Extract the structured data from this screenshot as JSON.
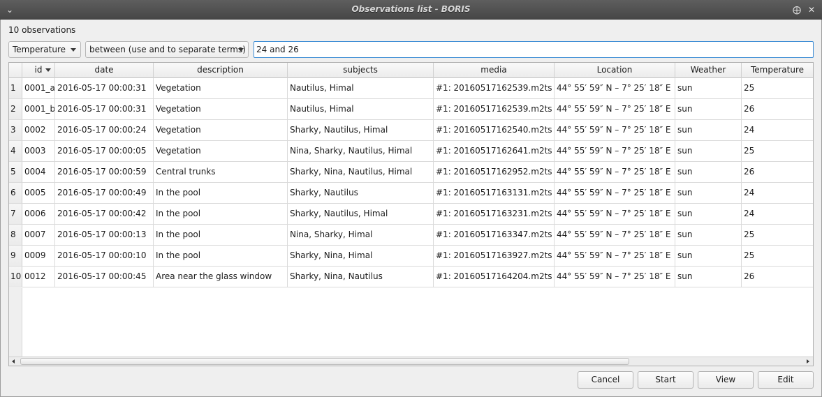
{
  "window": {
    "title": "Observations list - BORIS"
  },
  "count_label": "10 observations",
  "filter": {
    "field": "Temperature",
    "operator": "between (use and to separate terms)",
    "value": "24 and 26"
  },
  "table": {
    "columns": [
      "id",
      "date",
      "description",
      "subjects",
      "media",
      "Location",
      "Weather",
      "Temperature"
    ],
    "sorted_column": "id",
    "rows": [
      {
        "num": "1",
        "id": "0001_a",
        "date": "2016-05-17 00:00:31",
        "description": "Vegetation",
        "subjects": "Nautilus, Himal",
        "media": "#1: 20160517162539.m2ts",
        "location": "44° 55′ 59″ N – 7° 25′ 18″ E",
        "weather": "sun",
        "temperature": "25"
      },
      {
        "num": "2",
        "id": "0001_b",
        "date": "2016-05-17 00:00:31",
        "description": "Vegetation",
        "subjects": "Nautilus, Himal",
        "media": "#1: 20160517162539.m2ts",
        "location": "44° 55′ 59″ N – 7° 25′ 18″ E",
        "weather": "sun",
        "temperature": "26"
      },
      {
        "num": "3",
        "id": "0002",
        "date": "2016-05-17 00:00:24",
        "description": "Vegetation",
        "subjects": "Sharky, Nautilus, Himal",
        "media": "#1: 20160517162540.m2ts",
        "location": "44° 55′ 59″ N – 7° 25′ 18″ E",
        "weather": "sun",
        "temperature": "24"
      },
      {
        "num": "4",
        "id": "0003",
        "date": "2016-05-17 00:00:05",
        "description": "Vegetation",
        "subjects": "Nina, Sharky, Nautilus, Himal",
        "media": "#1: 20160517162641.m2ts",
        "location": "44° 55′ 59″ N – 7° 25′ 18″ E",
        "weather": "sun",
        "temperature": "25"
      },
      {
        "num": "5",
        "id": "0004",
        "date": "2016-05-17 00:00:59",
        "description": "Central trunks",
        "subjects": "Sharky, Nina, Nautilus, Himal",
        "media": "#1: 20160517162952.m2ts",
        "location": "44° 55′ 59″ N – 7° 25′ 18″ E",
        "weather": "sun",
        "temperature": "26"
      },
      {
        "num": "6",
        "id": "0005",
        "date": "2016-05-17 00:00:49",
        "description": "In the pool",
        "subjects": "Sharky, Nautilus",
        "media": "#1: 20160517163131.m2ts",
        "location": "44° 55′ 59″ N – 7° 25′ 18″ E",
        "weather": "sun",
        "temperature": "24"
      },
      {
        "num": "7",
        "id": "0006",
        "date": "2016-05-17 00:00:42",
        "description": "In the pool",
        "subjects": "Sharky, Nautilus, Himal",
        "media": "#1: 20160517163231.m2ts",
        "location": "44° 55′ 59″ N – 7° 25′ 18″ E",
        "weather": "sun",
        "temperature": "24"
      },
      {
        "num": "8",
        "id": "0007",
        "date": "2016-05-17 00:00:13",
        "description": "In the pool",
        "subjects": "Nina, Sharky, Himal",
        "media": "#1: 20160517163347.m2ts",
        "location": "44° 55′ 59″ N – 7° 25′ 18″ E",
        "weather": "sun",
        "temperature": "25"
      },
      {
        "num": "9",
        "id": "0009",
        "date": "2016-05-17 00:00:10",
        "description": "In the pool",
        "subjects": "Sharky, Nina, Himal",
        "media": "#1: 20160517163927.m2ts",
        "location": "44° 55′ 59″ N – 7° 25′ 18″ E",
        "weather": "sun",
        "temperature": "25"
      },
      {
        "num": "10",
        "id": "0012",
        "date": "2016-05-17 00:00:45",
        "description": "Area near the glass window",
        "subjects": "Sharky, Nina, Nautilus",
        "media": "#1: 20160517164204.m2ts",
        "location": "44° 55′ 59″ N – 7° 25′ 18″ E",
        "weather": "sun",
        "temperature": "26"
      }
    ]
  },
  "buttons": {
    "cancel": "Cancel",
    "start": "Start",
    "view": "View",
    "edit": "Edit"
  },
  "titlebar_icons": {
    "menu": "chevron-down-icon",
    "pin": "pin-icon",
    "close": "close-icon"
  }
}
